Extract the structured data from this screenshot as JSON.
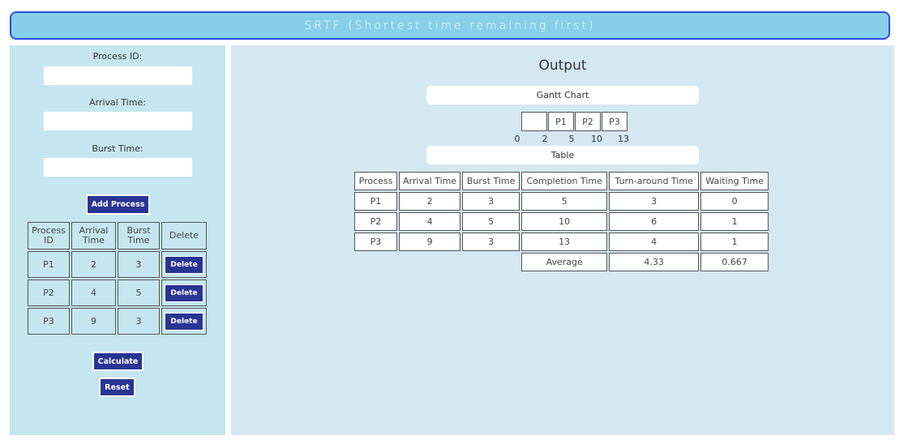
{
  "header": {
    "title": "SRTF (Shortest time remaining first)"
  },
  "form": {
    "process_id_label": "Process ID:",
    "arrival_time_label": "Arrival Time:",
    "burst_time_label": "Burst Time:",
    "process_id_value": "",
    "arrival_time_value": "",
    "burst_time_value": "",
    "add_button": "Add Process"
  },
  "process_table": {
    "headers": [
      "Process ID",
      "Arrival Time",
      "Burst Time",
      "Delete"
    ],
    "rows": [
      {
        "id": "P1",
        "arrival": "2",
        "burst": "3",
        "action": "Delete"
      },
      {
        "id": "P2",
        "arrival": "4",
        "burst": "5",
        "action": "Delete"
      },
      {
        "id": "P3",
        "arrival": "9",
        "burst": "3",
        "action": "Delete"
      }
    ]
  },
  "actions": {
    "calculate": "Calculate",
    "reset": "Reset"
  },
  "output": {
    "title": "Output",
    "gantt_label": "Gantt Chart",
    "gantt_blocks": [
      "",
      "P1",
      "P2",
      "P3"
    ],
    "gantt_times": [
      "0",
      "2",
      "5",
      "10",
      "13"
    ],
    "table_label": "Table",
    "result_headers": [
      "Process",
      "Arrival Time",
      "Burst Time",
      "Completion Time",
      "Turn-around Time",
      "Waiting Time"
    ],
    "result_rows": [
      [
        "P1",
        "2",
        "3",
        "5",
        "3",
        "0"
      ],
      [
        "P2",
        "4",
        "5",
        "10",
        "6",
        "1"
      ],
      [
        "P3",
        "9",
        "3",
        "13",
        "4",
        "1"
      ]
    ],
    "average_label": "Average",
    "average_tat": "4.33",
    "average_wt": "0.667"
  }
}
